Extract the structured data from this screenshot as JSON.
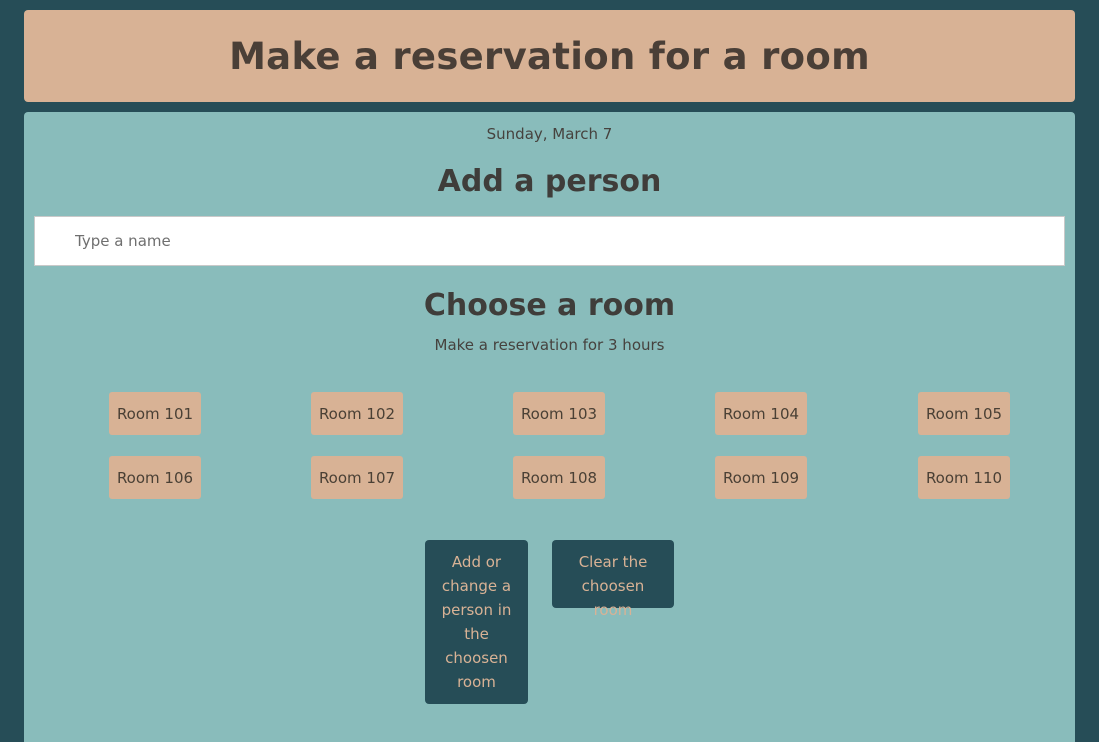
{
  "header": {
    "title": "Make a reservation for a room"
  },
  "main": {
    "date": "Sunday, March 7",
    "add_person_heading": "Add a person",
    "name_input": {
      "value": "",
      "placeholder": "Type a name"
    },
    "choose_room_heading": "Choose a room",
    "subtitle": "Make a reservation for 3 hours",
    "rooms": [
      "Room 101",
      "Room 102",
      "Room 103",
      "Room 104",
      "Room 105",
      "Room 106",
      "Room 107",
      "Room 108",
      "Room 109",
      "Room 110"
    ],
    "actions": {
      "add_change_label": "Add or change a person in the choosen room",
      "clear_label": "Clear the choosen room"
    }
  },
  "colors": {
    "background": "#264d57",
    "header_bg": "#d8b295",
    "panel_bg": "#89bcbb",
    "room_button_bg": "#d8b295",
    "action_button_bg": "#264d57",
    "action_button_text": "#d8b295"
  }
}
